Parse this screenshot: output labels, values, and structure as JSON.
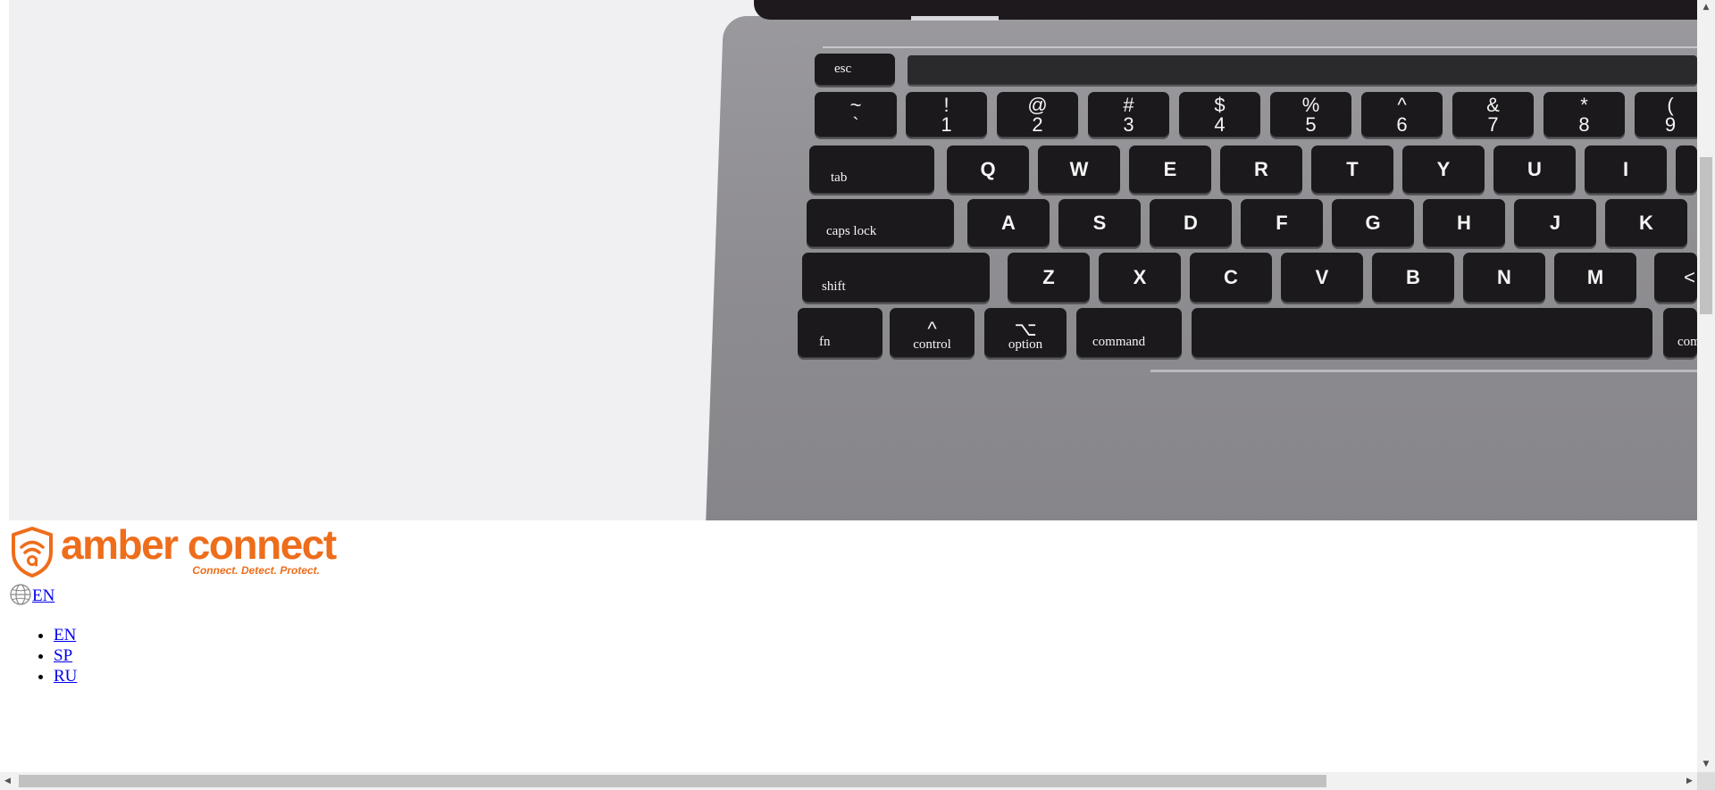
{
  "hero": {
    "keyboard": {
      "esc": "esc",
      "number_row": [
        {
          "top": "~",
          "bottom": "`"
        },
        {
          "top": "!",
          "bottom": "1"
        },
        {
          "top": "@",
          "bottom": "2"
        },
        {
          "top": "#",
          "bottom": "3"
        },
        {
          "top": "$",
          "bottom": "4"
        },
        {
          "top": "%",
          "bottom": "5"
        },
        {
          "top": "^",
          "bottom": "6"
        },
        {
          "top": "&",
          "bottom": "7"
        },
        {
          "top": "*",
          "bottom": "8"
        },
        {
          "top": "(",
          "bottom": "9"
        }
      ],
      "tab": "tab",
      "qwerty_row": [
        "Q",
        "W",
        "E",
        "R",
        "T",
        "Y",
        "U",
        "I"
      ],
      "caps": "caps lock",
      "home_row": [
        "A",
        "S",
        "D",
        "F",
        "G",
        "H",
        "J",
        "K"
      ],
      "shift": "shift",
      "bottom_letters": [
        "Z",
        "X",
        "C",
        "V",
        "B",
        "N",
        "M"
      ],
      "comma_key": "<",
      "fn": "fn",
      "control": {
        "symbol": "^",
        "label": "control"
      },
      "option": {
        "symbol": "⌥",
        "label": "option"
      },
      "command": "command",
      "command_right": "com"
    }
  },
  "logo": {
    "name": "amber connect",
    "tagline": "Connect. Detect. Protect.",
    "brand_color": "#ee6d1b"
  },
  "language": {
    "current": "EN",
    "icon": "globe-icon",
    "options": [
      "EN",
      "SP",
      "RU"
    ]
  }
}
